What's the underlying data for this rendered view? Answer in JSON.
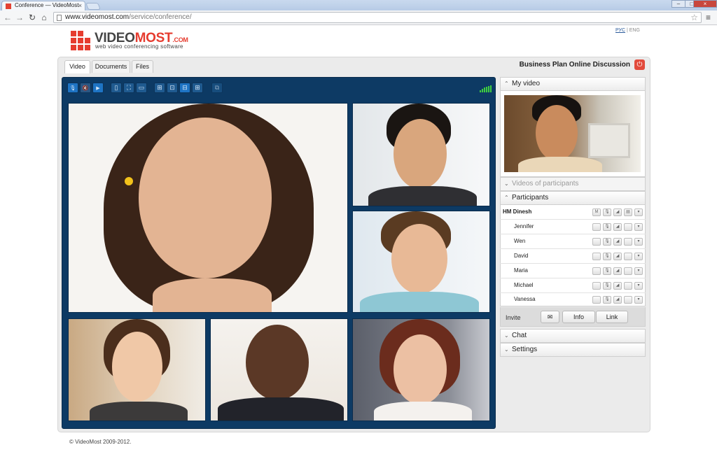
{
  "browser": {
    "tab_title": "Conference — VideoMost",
    "tab_close": "×",
    "url_host": "www.videomost.com",
    "url_path": "/service/conference/",
    "back_icon": "←",
    "forward_icon": "→",
    "reload_icon": "↻",
    "home_icon": "⌂",
    "star_icon": "☆",
    "menu_icon": "≡",
    "min_icon": "–",
    "max_icon": "□",
    "close_icon": "×"
  },
  "site": {
    "logo_video": "VIDEO",
    "logo_most": "MOST",
    "logo_com": ".COM",
    "logo_subtitle": "web video conferencing software",
    "lang_ru": "РУС",
    "lang_sep": "|",
    "lang_en": "ENG",
    "footer": "© VideoMost 2009-2012."
  },
  "tabs": [
    {
      "label": "Video",
      "active": true
    },
    {
      "label": "Documents",
      "active": false
    },
    {
      "label": "Files",
      "active": false
    }
  ],
  "conference_title": "Business Plan Online Discussion",
  "power_icon": "⏻",
  "video_toolbar": {
    "mic_icon": "🎙",
    "speaker_muted_icon": "🔇",
    "camera_icon": "▶",
    "layout_icons": [
      "▯",
      "⛶",
      "▭",
      "⊞",
      "⊡",
      "⊟",
      "⊞",
      "⧉"
    ]
  },
  "sidebar": {
    "my_video": "My video",
    "videos_of_participants": "Videos of participants",
    "participants": "Participants",
    "chat": "Chat",
    "settings": "Settings",
    "chev_up": "⌃",
    "chev_down": "⌄"
  },
  "participants": [
    {
      "name": "HM Dinesh",
      "host": true
    },
    {
      "name": "Jennifer",
      "host": false
    },
    {
      "name": "Wen",
      "host": false
    },
    {
      "name": "David",
      "host": false
    },
    {
      "name": "Maria",
      "host": false
    },
    {
      "name": "Michael",
      "host": false
    },
    {
      "name": "Vanessa",
      "host": false
    }
  ],
  "participant_controls": {
    "host_letter": "M",
    "mic": "🎙",
    "volume": "◢",
    "screen": "▤",
    "dropdown": "▾"
  },
  "invite": {
    "label": "Invite",
    "mail_icon": "✉",
    "info": "Info",
    "link": "Link"
  },
  "colors": {
    "brand_red": "#e63c2f",
    "video_bg": "#0d3a64",
    "signal_green": "#3fcf3f"
  }
}
